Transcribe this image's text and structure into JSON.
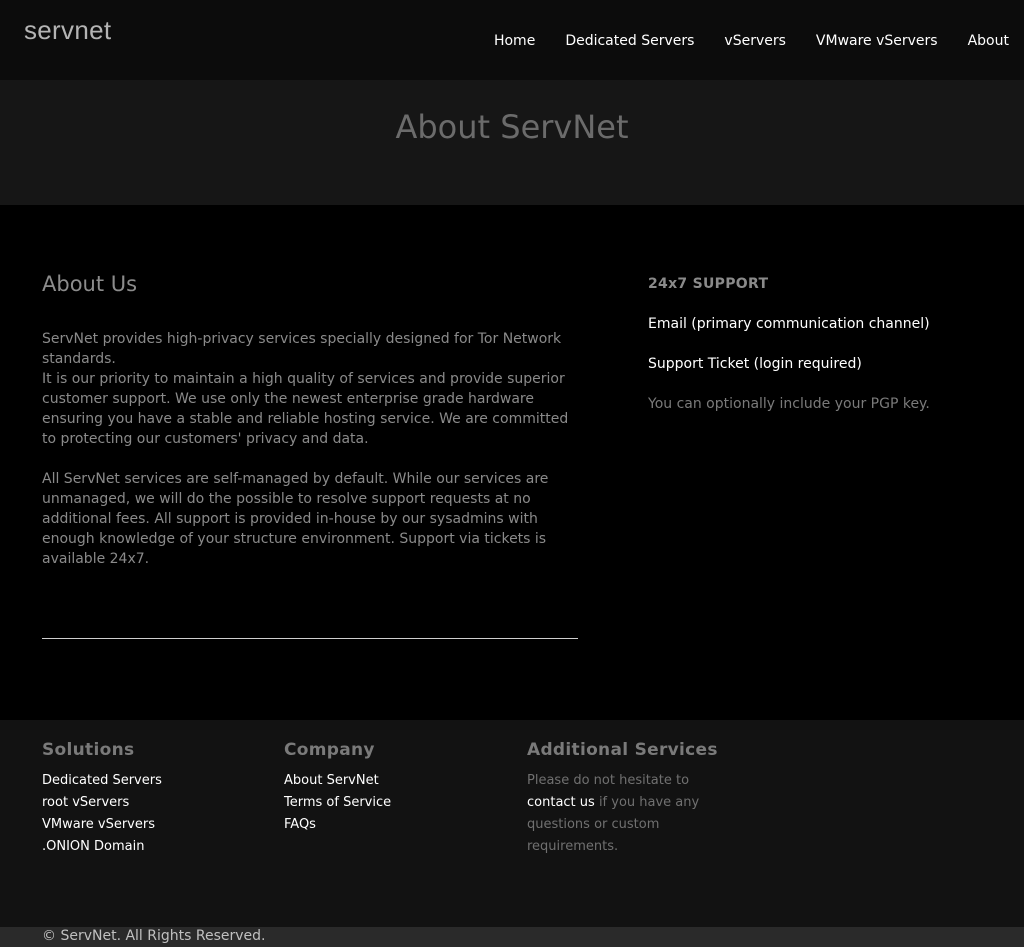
{
  "brand": {
    "logo": "servnet"
  },
  "nav": {
    "items": [
      "Home",
      "Dedicated Servers",
      "vServers",
      "VMware vServers",
      "About"
    ]
  },
  "hero": {
    "title": "About ServNet"
  },
  "about": {
    "heading": "About Us",
    "p1_line1": "ServNet provides high-privacy services specially designed for Tor Network standards.",
    "p1_line2": "It is our priority to maintain a high quality of services and provide superior customer support. We use only the newest enterprise grade hardware ensuring you have a stable and reliable hosting service. We are committed to protecting our customers' privacy and data.",
    "p2": "All ServNet services are self-managed by default. While our services are unmanaged, we will do the possible to resolve support requests at no additional fees. All support is provided in-house by our sysadmins with enough knowledge of your structure environment. Support via tickets is available 24x7."
  },
  "support": {
    "title": "24x7 SUPPORT",
    "email": "Email (primary communication channel)",
    "ticket": "Support Ticket (login required)",
    "pgp": "You can optionally include your PGP key."
  },
  "footer": {
    "solutions": {
      "title": "Solutions",
      "links": [
        "Dedicated Servers",
        "root vServers",
        "VMware vServers",
        ".ONION Domain"
      ]
    },
    "company": {
      "title": "Company",
      "links": [
        "About ServNet",
        "Terms of Service",
        "FAQs"
      ]
    },
    "additional": {
      "title": "Additional Services",
      "text_before": "Please do not hesitate to",
      "link": "contact us",
      "text_after": "if you have any questions or custom requirements."
    }
  },
  "copyright": "© ServNet. All Rights Reserved."
}
